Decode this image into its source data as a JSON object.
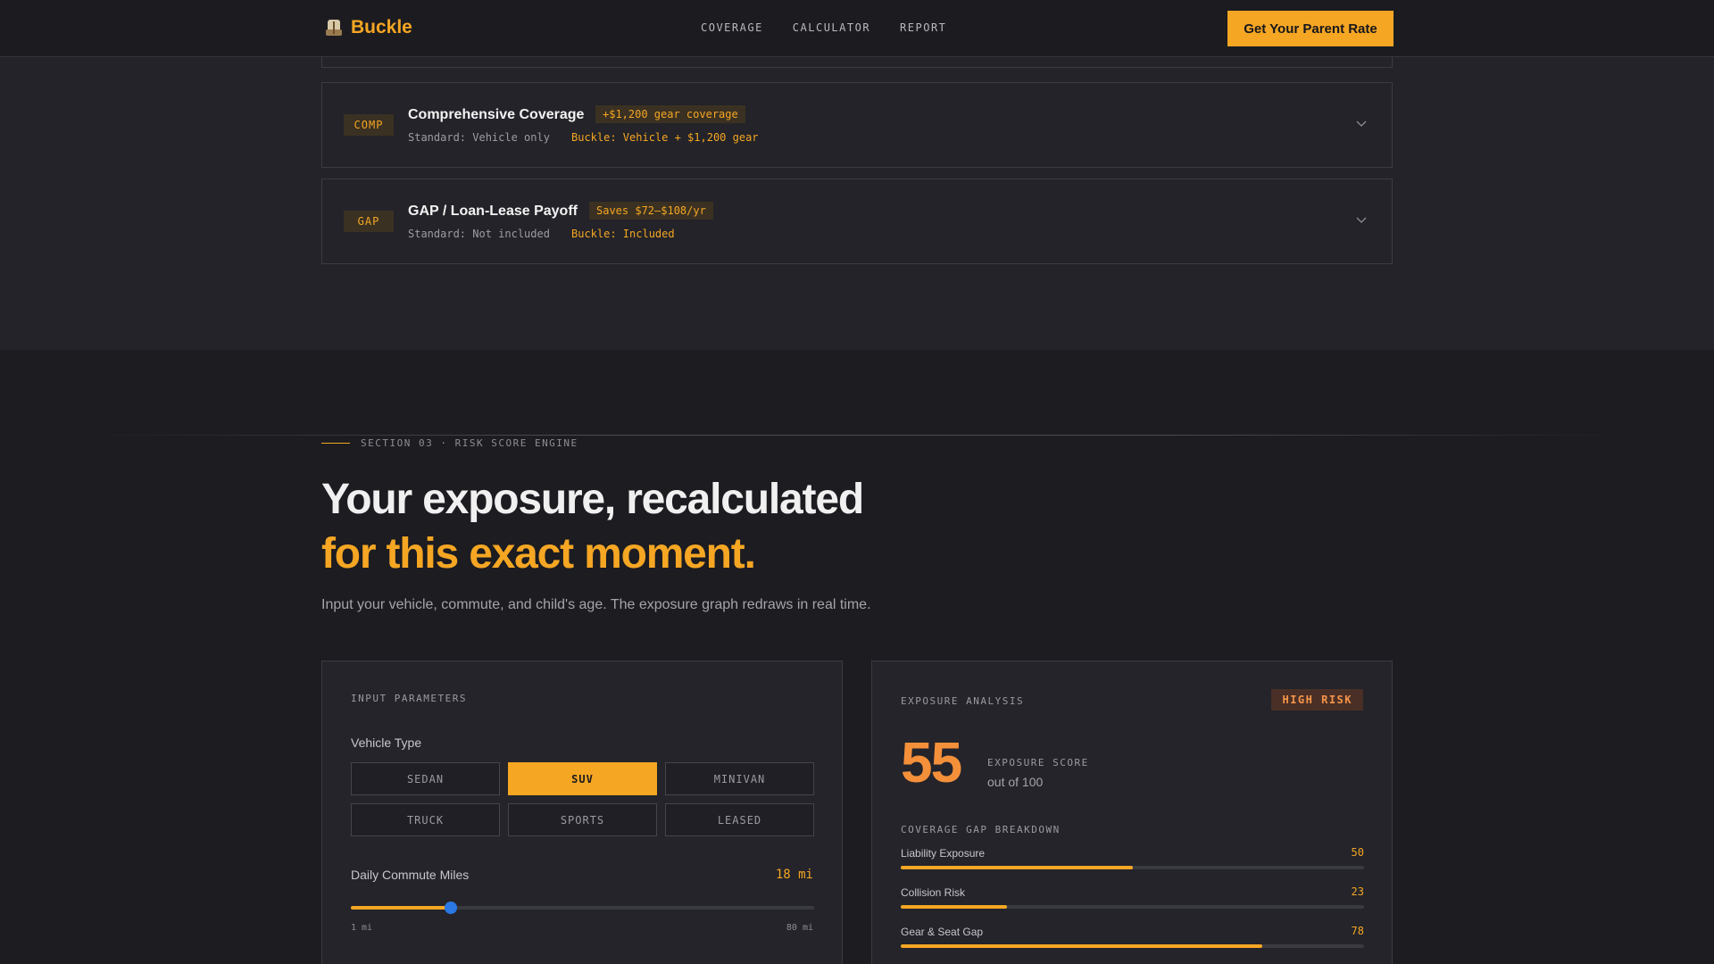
{
  "nav": {
    "brand": "Buckle",
    "links": [
      "COVERAGE",
      "CALCULATOR",
      "REPORT"
    ],
    "cta": "Get Your Parent Rate"
  },
  "coverage_cards": [
    {
      "code": "COMP",
      "title": "Comprehensive Coverage",
      "pill": "+$1,200 gear coverage",
      "standard": "Standard: Vehicle only",
      "buckle": "Buckle: Vehicle + $1,200 gear"
    },
    {
      "code": "GAP",
      "title": "GAP / Loan-Lease Payoff",
      "pill": "Saves $72–$108/yr",
      "standard": "Standard: Not included",
      "buckle": "Buckle: Included"
    }
  ],
  "section": {
    "eyebrow": "SECTION 03 · RISK SCORE ENGINE",
    "headline_line1": "Your exposure, recalculated",
    "headline_line2": "for this exact moment.",
    "subhead": "Input your vehicle, commute, and child's age. The exposure graph redraws in real time."
  },
  "inputs": {
    "panel_label": "INPUT PARAMETERS",
    "vehicle_label": "Vehicle Type",
    "vehicle_options": [
      "SEDAN",
      "SUV",
      "MINIVAN",
      "TRUCK",
      "SPORTS",
      "LEASED"
    ],
    "vehicle_selected": "SUV",
    "commute_label": "Daily Commute Miles",
    "commute_value": 18,
    "commute_value_text": "18 mi",
    "commute_min": 1,
    "commute_max": 80,
    "commute_min_label": "1 mi",
    "commute_max_label": "80 mi"
  },
  "exposure": {
    "panel_label": "EXPOSURE ANALYSIS",
    "risk_badge": "HIGH RISK",
    "score": "55",
    "score_label": "EXPOSURE SCORE",
    "score_sub": "out of 100",
    "breakdown_label": "COVERAGE GAP BREAKDOWN",
    "gaps": [
      {
        "name": "Liability Exposure",
        "value": 50
      },
      {
        "name": "Collision Risk",
        "value": 23
      },
      {
        "name": "Gear & Seat Gap",
        "value": 78
      }
    ]
  },
  "colors": {
    "accent": "#f5a623",
    "score": "#f5903a",
    "background": "#1c1c21",
    "panel": "#24242a",
    "slider_thumb": "#2b78e4"
  }
}
